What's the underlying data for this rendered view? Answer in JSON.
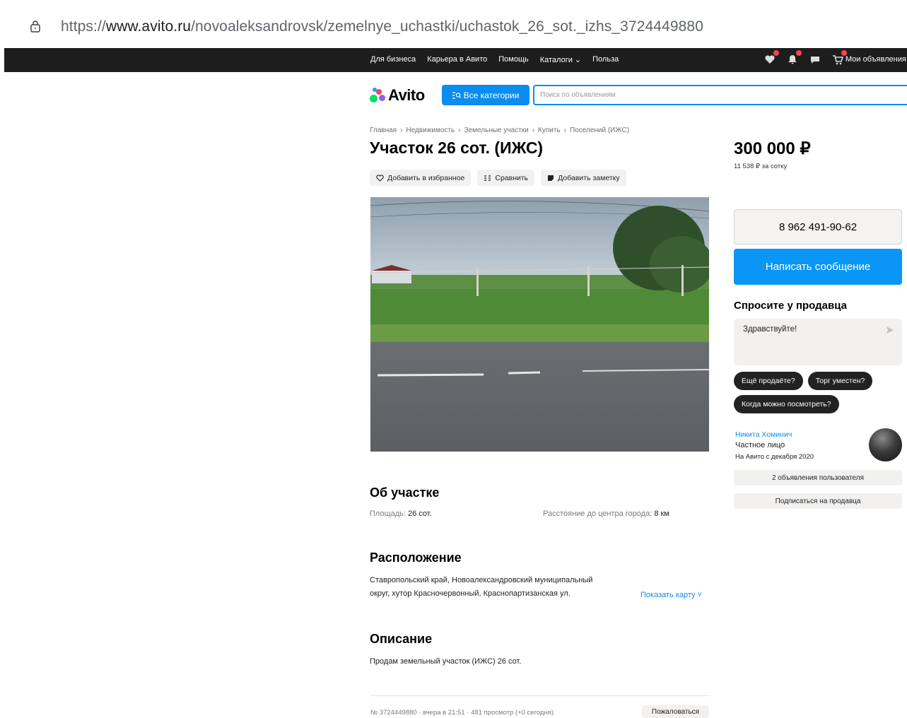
{
  "browser": {
    "url_scheme": "https://",
    "url_domain": "www.avito.ru",
    "url_path": "/novoaleksandrovsk/zemelnye_uchastki/uchastok_26_sot._izhs_3724449880"
  },
  "topnav": {
    "links": [
      "Для бизнеса",
      "Карьера в Авито",
      "Помощь",
      "Каталоги ⌄",
      "Польза"
    ],
    "my_ads": "Мои объявления"
  },
  "header": {
    "logo": "Avito",
    "categories_button": "Все категории",
    "search_placeholder": "Поиск по объявлениям"
  },
  "breadcrumb": [
    "Главная",
    "Недвижимость",
    "Земельные участки",
    "Купить",
    "Поселений (ИЖС)"
  ],
  "listing": {
    "title": "Участок 26 сот. (ИЖС)",
    "actions": {
      "favorite": "Добавить в избранное",
      "compare": "Сравнить",
      "note": "Добавить заметку"
    },
    "about": {
      "heading": "Об участке",
      "area_label": "Площадь:",
      "area_value": "26 сот.",
      "distance_label": "Расстояние до центра города:",
      "distance_value": "8 км"
    },
    "location": {
      "heading": "Расположение",
      "line1": "Ставропольский край, Новоалександровский муниципальный",
      "line2": "округ, хутор Красночервонный, Краснопартизанская ул.",
      "show_map": "Показать карту ˅"
    },
    "description": {
      "heading": "Описание",
      "text": "Продам земельный участок (ИЖС) 26 сот."
    },
    "footer": {
      "meta": "№ 3724449880 · вчера в 21:51 · 481 просмотр (+0 сегодня)",
      "report": "Пожаловаться"
    }
  },
  "sidebar": {
    "price": "300 000 ₽",
    "price_per_unit": "11 538 ₽ за сотку",
    "phone": "8 962 491-90-62",
    "write_message": "Написать сообщение",
    "ask_title": "Спросите у продавца",
    "ask_text": "Здравствуйте!",
    "chips": [
      "Ещё продаёте?",
      "Торг уместен?",
      "Когда можно посмотреть?"
    ],
    "seller": {
      "name": "Никита Хоминич",
      "type": "Частное лицо",
      "since": "На Авито с декабря 2020"
    },
    "user_ads": "2 объявления пользователя",
    "subscribe": "Подписаться на продавца"
  },
  "colors": {
    "accent": "#0a8cf0",
    "nav_bg": "#1d1d1d",
    "badge": "#ff4053"
  }
}
